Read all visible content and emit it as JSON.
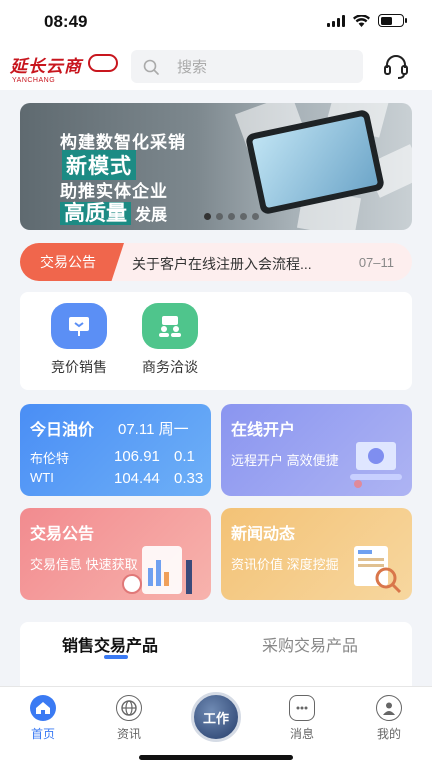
{
  "status": {
    "time": "08:49"
  },
  "header": {
    "logo_text": "延长云商",
    "logo_sub": "YANCHANG",
    "search_placeholder": "搜索"
  },
  "banner": {
    "line1": "构建数智化采销",
    "line2": "新模式",
    "line3": "助推实体企业",
    "line4_highlight": "高质量",
    "line4_rest": "发展",
    "dot_count": 5,
    "active_dot": 1
  },
  "notice": {
    "tag": "交易公告",
    "text": "关于客户在线注册入会流程...",
    "date": "07–11"
  },
  "quick_actions": [
    {
      "label": "竞价销售",
      "color": "#5b8ff5"
    },
    {
      "label": "商务洽谈",
      "color": "#4fc58c"
    }
  ],
  "cards": {
    "oil": {
      "title": "今日油价",
      "date": "07.11 周一",
      "rows": [
        {
          "name": "布伦特",
          "price": "106.91",
          "change": "0.1"
        },
        {
          "name": "WTI",
          "price": "104.44",
          "change": "0.33"
        }
      ]
    },
    "open": {
      "title": "在线开户",
      "sub": "远程开户 高效便捷"
    },
    "trade": {
      "title": "交易公告",
      "sub": "交易信息 快速获取"
    },
    "news": {
      "title": "新闻动态",
      "sub": "资讯价值 深度挖掘"
    }
  },
  "products": {
    "tab_active": "销售交易产品",
    "tab_inactive": "采购交易产品"
  },
  "tabbar": {
    "home": "首页",
    "info": "资讯",
    "work": "工作",
    "messages": "消息",
    "mine": "我的",
    "accent": "#3a7af3"
  }
}
